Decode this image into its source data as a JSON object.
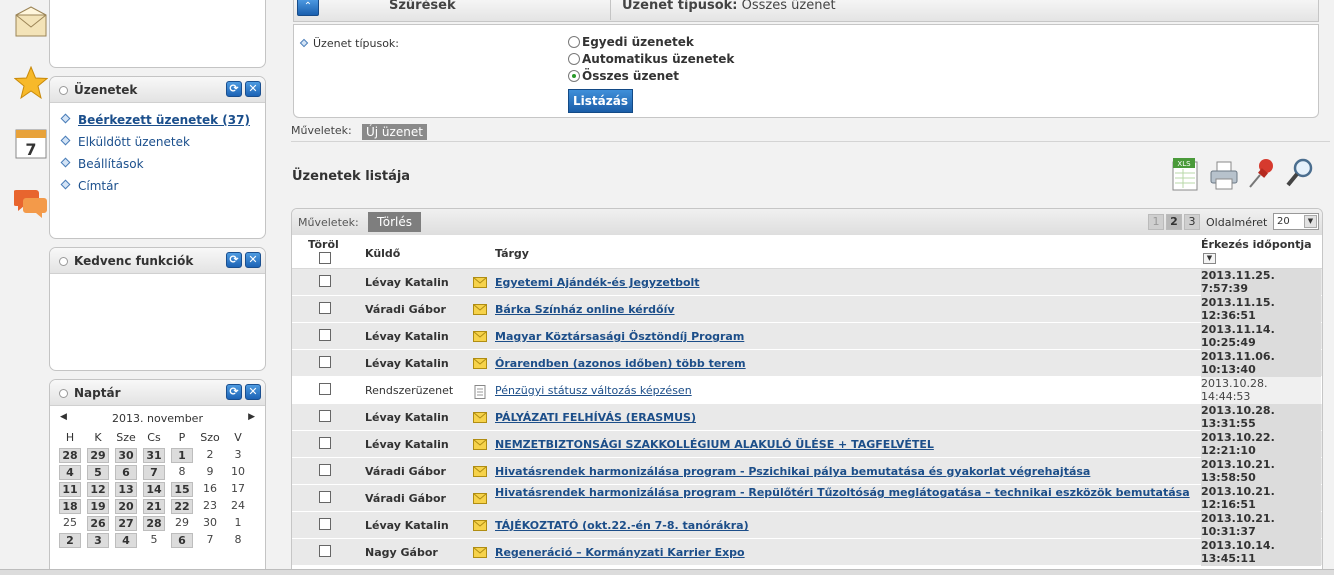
{
  "side_icons": [
    "envelope-icon",
    "star-icon",
    "calendar-icon",
    "chat-bubbles-icon"
  ],
  "calendar_icon_number": "7",
  "panels": {
    "messages": {
      "title": "Üzenetek",
      "items": [
        {
          "label": "Beérkezett üzenetek (37)",
          "active": true
        },
        {
          "label": "Elküldött üzenetek",
          "active": false
        },
        {
          "label": "Beállítások",
          "active": false
        },
        {
          "label": "Címtár",
          "active": false
        }
      ]
    },
    "favorites": {
      "title": "Kedvenc funkciók"
    },
    "calendar": {
      "title": "Naptár",
      "month": "2013. november",
      "weekdays": [
        "H",
        "K",
        "Sze",
        "Cs",
        "P",
        "Szo",
        "V"
      ],
      "weeks": [
        [
          {
            "d": "28",
            "a": true
          },
          {
            "d": "29",
            "a": true
          },
          {
            "d": "30",
            "a": true
          },
          {
            "d": "31",
            "a": true
          },
          {
            "d": "1",
            "a": true
          },
          {
            "d": "2",
            "a": false
          },
          {
            "d": "3",
            "a": false
          }
        ],
        [
          {
            "d": "4",
            "a": true
          },
          {
            "d": "5",
            "a": true
          },
          {
            "d": "6",
            "a": true
          },
          {
            "d": "7",
            "a": true
          },
          {
            "d": "8",
            "a": false
          },
          {
            "d": "9",
            "a": false
          },
          {
            "d": "10",
            "a": false
          }
        ],
        [
          {
            "d": "11",
            "a": true
          },
          {
            "d": "12",
            "a": true
          },
          {
            "d": "13",
            "a": true
          },
          {
            "d": "14",
            "a": true
          },
          {
            "d": "15",
            "a": true
          },
          {
            "d": "16",
            "a": false
          },
          {
            "d": "17",
            "a": false
          }
        ],
        [
          {
            "d": "18",
            "a": true
          },
          {
            "d": "19",
            "a": true
          },
          {
            "d": "20",
            "a": true
          },
          {
            "d": "21",
            "a": true
          },
          {
            "d": "22",
            "a": true
          },
          {
            "d": "23",
            "a": false
          },
          {
            "d": "24",
            "a": false
          }
        ],
        [
          {
            "d": "25",
            "a": false,
            "today": true
          },
          {
            "d": "26",
            "a": true
          },
          {
            "d": "27",
            "a": true
          },
          {
            "d": "28",
            "a": true
          },
          {
            "d": "29",
            "a": false
          },
          {
            "d": "30",
            "a": false
          },
          {
            "d": "1",
            "a": false
          }
        ],
        [
          {
            "d": "2",
            "a": true
          },
          {
            "d": "3",
            "a": true
          },
          {
            "d": "4",
            "a": true
          },
          {
            "d": "5",
            "a": false
          },
          {
            "d": "6",
            "a": true
          },
          {
            "d": "7",
            "a": false
          },
          {
            "d": "8",
            "a": false
          }
        ]
      ]
    }
  },
  "filter": {
    "bar_label": "Szűrések",
    "summary_key": "Üzenet típusok:",
    "summary_value": "Összes üzenet",
    "field_label": "Üzenet típusok:",
    "options": [
      {
        "label": "Egyedi üzenetek",
        "selected": false
      },
      {
        "label": "Automatikus üzenetek",
        "selected": false
      },
      {
        "label": "Összes üzenet",
        "selected": true
      }
    ],
    "list_button": "Listázás"
  },
  "operations": {
    "label": "Műveletek:",
    "new_message": "Új üzenet"
  },
  "list": {
    "title": "Üzenetek listája",
    "tools": [
      "excel-export-icon",
      "print-icon",
      "pin-icon",
      "search-icon"
    ],
    "ops_label": "Műveletek:",
    "delete_button": "Törlés",
    "pages": [
      "1",
      "2",
      "3"
    ],
    "current_page": "1",
    "page_size_label": "Oldalméret",
    "page_size": "20",
    "columns": {
      "delete": "Töröl",
      "sender": "Küldő",
      "subject": "Tárgy",
      "arrival": "Érkezés időpontja"
    },
    "rows": [
      {
        "sender": "Lévay Katalin",
        "subject": "Egyetemi Ajándék-és Jegyzetbolt",
        "date": "2013.11.25.",
        "time": "7:57:39",
        "unread": true,
        "system": false
      },
      {
        "sender": "Váradi Gábor",
        "subject": "Bárka Színház online kérdőív",
        "date": "2013.11.15.",
        "time": "12:36:51",
        "unread": true,
        "system": false
      },
      {
        "sender": "Lévay Katalin",
        "subject": "Magyar Köztársasági Ösztöndíj Program",
        "date": "2013.11.14.",
        "time": "10:25:49",
        "unread": true,
        "system": false
      },
      {
        "sender": "Lévay Katalin",
        "subject": "Órarendben (azonos időben) több terem",
        "date": "2013.11.06.",
        "time": "10:13:40",
        "unread": true,
        "system": false
      },
      {
        "sender": "Rendszerüzenet",
        "subject": "Pénzügyi státusz változás képzésen",
        "date": "2013.10.28.",
        "time": "14:44:53",
        "unread": false,
        "system": true
      },
      {
        "sender": "Lévay Katalin",
        "subject": "PÁLYÁZATI FELHÍVÁS (ERASMUS)",
        "date": "2013.10.28.",
        "time": "13:31:55",
        "unread": true,
        "system": false
      },
      {
        "sender": "Lévay Katalin",
        "subject": "NEMZETBIZTONSÁGI SZAKKOLLÉGIUM ALAKULÓ ÜLÉSE + TAGFELVÉTEL",
        "date": "2013.10.22.",
        "time": "12:21:10",
        "unread": true,
        "system": false
      },
      {
        "sender": "Váradi Gábor",
        "subject": "Hivatásrendek harmonizálása program - Pszichikai pálya bemutatása és gyakorlat végrehajtása",
        "date": "2013.10.21.",
        "time": "13:58:50",
        "unread": true,
        "system": false
      },
      {
        "sender": "Váradi Gábor",
        "subject": "Hivatásrendek harmonizálása program - Repülőtéri Tűzoltóság meglátogatása – technikai eszközök bemutatása",
        "date": "2013.10.21.",
        "time": "12:16:51",
        "unread": true,
        "system": false,
        "tall": true
      },
      {
        "sender": "Lévay Katalin",
        "subject": "TÁJÉKOZTATÓ (okt.22.-én 7-8. tanórákra)",
        "date": "2013.10.21.",
        "time": "10:31:37",
        "unread": true,
        "system": false
      },
      {
        "sender": "Nagy Gábor",
        "subject": "Regeneráció – Kormányzati Karrier Expo",
        "date": "2013.10.14.",
        "time": "13:45:11",
        "unread": true,
        "system": false
      }
    ]
  },
  "colors": {
    "accent_blue": "#1b5ea8",
    "link": "#1c4e89",
    "unread_row": "#e9e9e9",
    "today": "#cc0000"
  }
}
